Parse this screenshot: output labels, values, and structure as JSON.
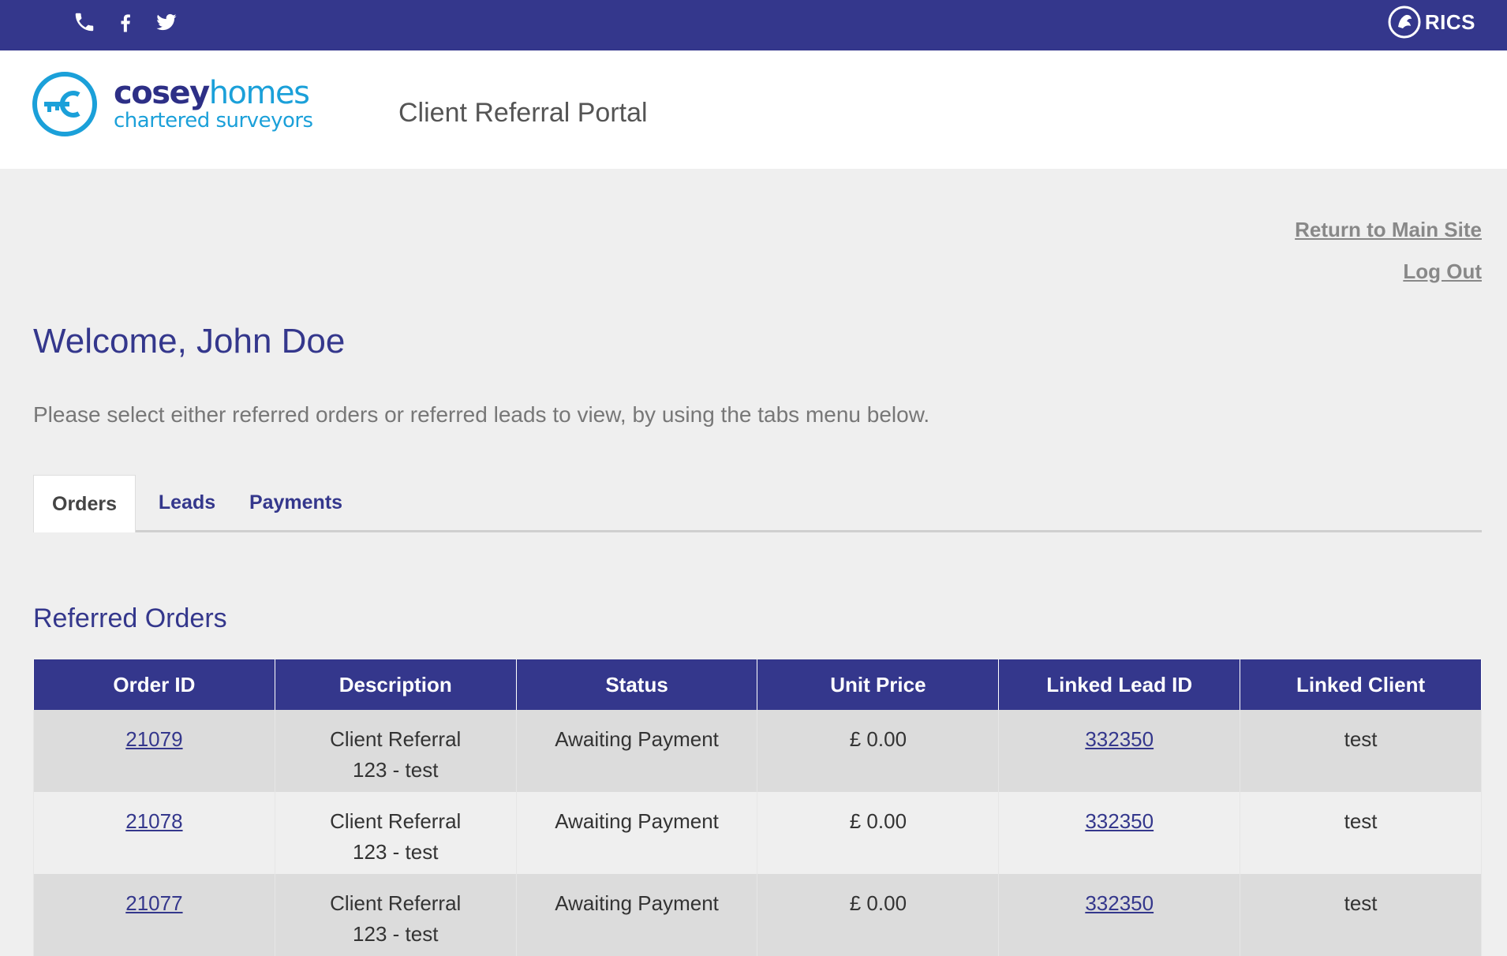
{
  "topbar": {
    "social_icons": [
      "phone-icon",
      "facebook-icon",
      "twitter-icon"
    ],
    "rics_logo_text": "RICS",
    "bg_color": "#34378c"
  },
  "header": {
    "logo": {
      "brand_part1": "cosey",
      "brand_part2": "homes",
      "tagline": "chartered surveyors"
    },
    "portal_title": "Client Referral Portal"
  },
  "links": {
    "return_main_site": "Return to Main Site",
    "log_out": "Log Out"
  },
  "welcome": "Welcome, John Doe",
  "instruction": "Please select either referred orders or referred leads to view, by using the tabs menu below.",
  "tabs": [
    {
      "label": "Orders",
      "active": true
    },
    {
      "label": "Leads",
      "active": false
    },
    {
      "label": "Payments",
      "active": false
    }
  ],
  "section_title": "Referred Orders",
  "table": {
    "headers": [
      "Order ID",
      "Description",
      "Status",
      "Unit Price",
      "Linked Lead ID",
      "Linked Client"
    ],
    "rows": [
      {
        "order_id": "21079",
        "description": "Client Referral 123 - test",
        "status": "Awaiting Payment",
        "unit_price": "£ 0.00",
        "linked_lead_id": "332350",
        "linked_client": "test"
      },
      {
        "order_id": "21078",
        "description": "Client Referral 123 - test",
        "status": "Awaiting Payment",
        "unit_price": "£ 0.00",
        "linked_lead_id": "332350",
        "linked_client": "test"
      },
      {
        "order_id": "21077",
        "description": "Client Referral 123 - test",
        "status": "Awaiting Payment",
        "unit_price": "£ 0.00",
        "linked_lead_id": "332350",
        "linked_client": "test"
      }
    ]
  },
  "colors": {
    "brand_navy": "#34378c",
    "brand_cyan": "#1ba0d9",
    "page_bg": "#efefef"
  }
}
